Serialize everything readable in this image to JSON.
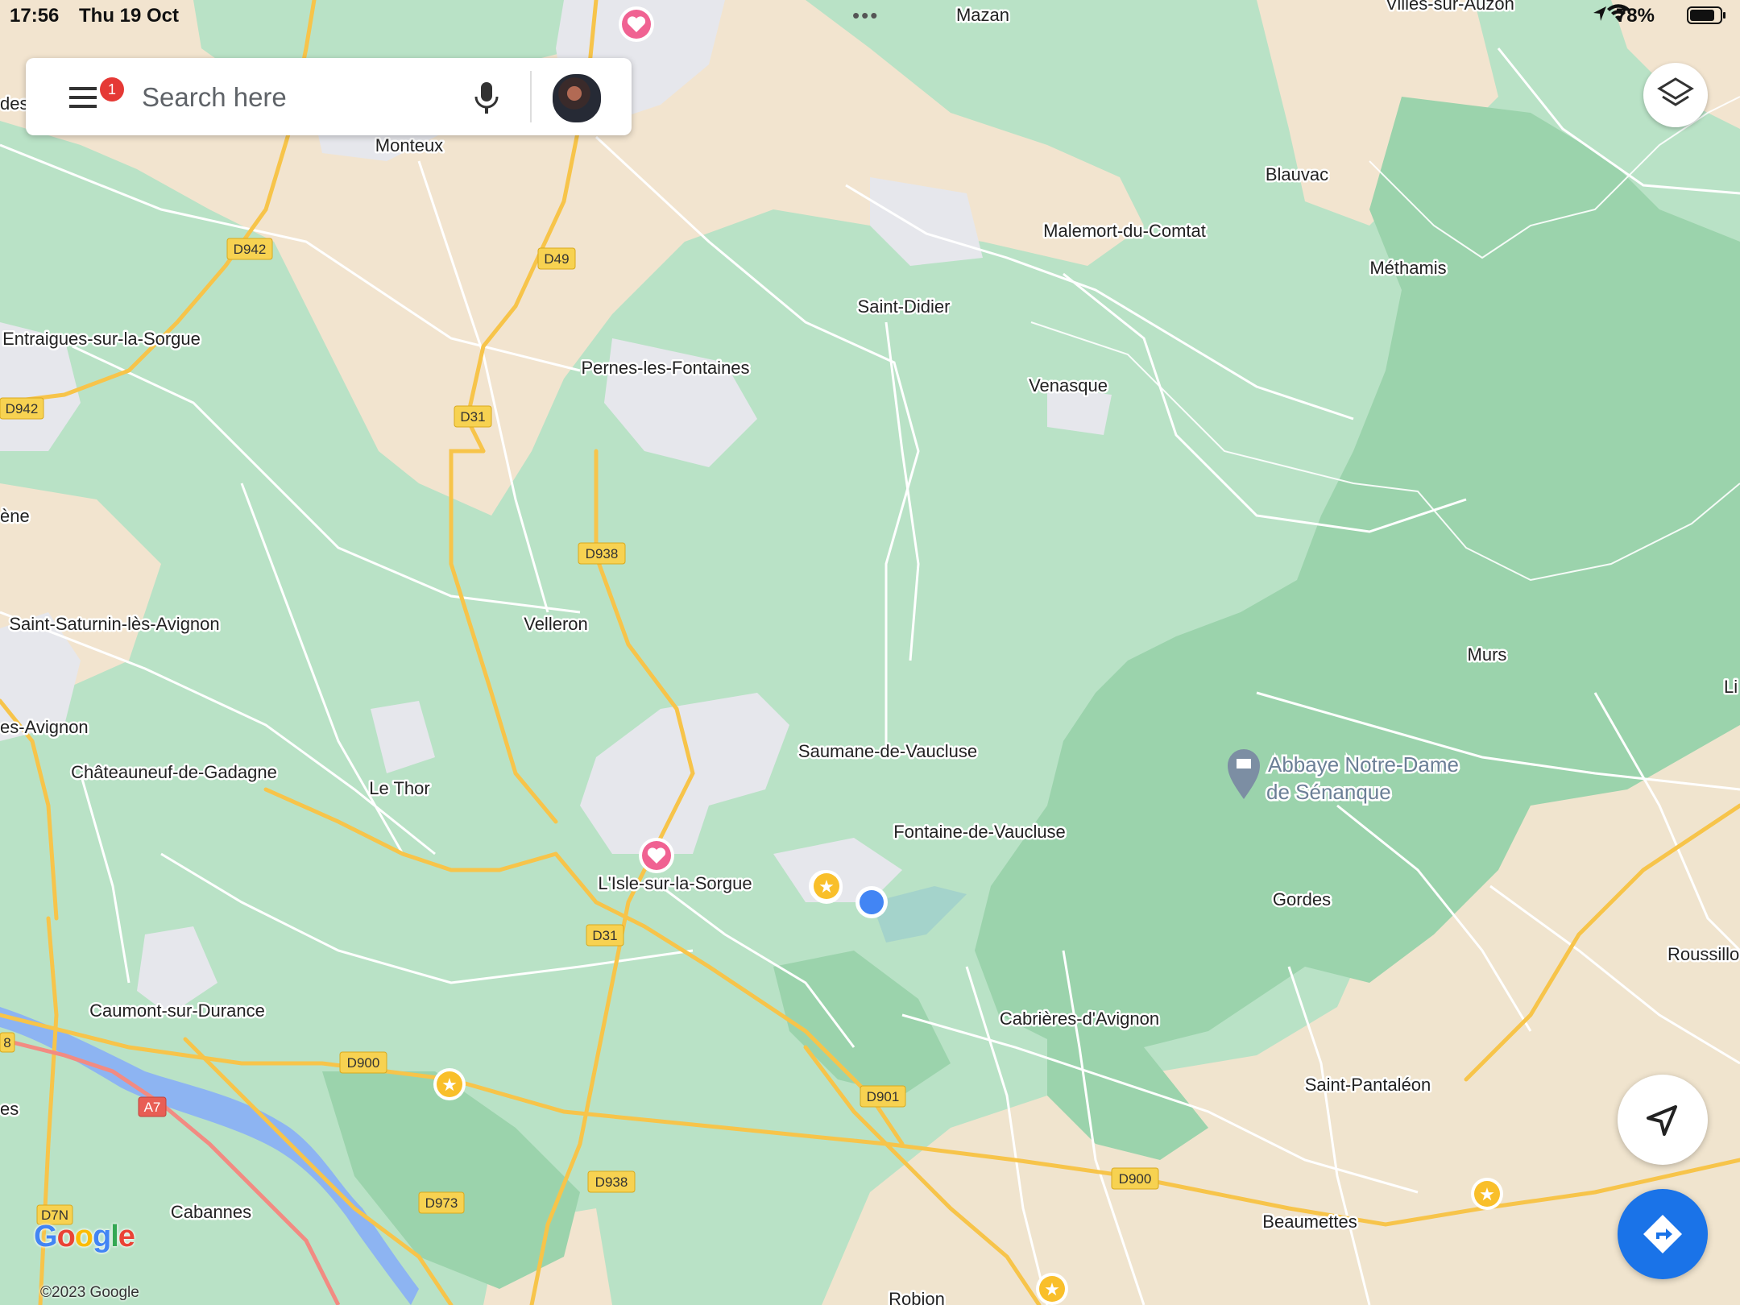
{
  "status_bar": {
    "time": "17:56",
    "date": "Thu 19 Oct",
    "battery": "78%"
  },
  "search": {
    "placeholder": "Search here",
    "notification_count": "1"
  },
  "places": [
    {
      "name": "Mazan"
    },
    {
      "name": "Villes-sur-Auzon"
    },
    {
      "name": "Monteux"
    },
    {
      "name": "Blauvac"
    },
    {
      "name": "Malemort-du-Comtat"
    },
    {
      "name": "Méthamis"
    },
    {
      "name": "Saint-Didier"
    },
    {
      "name": "Entraigues-sur-la-Sorgue"
    },
    {
      "name": "Pernes-les-Fontaines"
    },
    {
      "name": "Venasque"
    },
    {
      "name": "ène"
    },
    {
      "name": "Saint-Saturnin-lès-Avignon"
    },
    {
      "name": "Velleron"
    },
    {
      "name": "Murs"
    },
    {
      "name": "Li"
    },
    {
      "name": "es-Avignon"
    },
    {
      "name": "Saumane-de-Vaucluse"
    },
    {
      "name": "Châteauneuf-de-Gadagne"
    },
    {
      "name": "Le Thor"
    },
    {
      "name": "Fontaine-de-Vaucluse"
    },
    {
      "name": "L'Isle-sur-la-Sorgue"
    },
    {
      "name": "Gordes"
    },
    {
      "name": "Roussillo"
    },
    {
      "name": "Caumont-sur-Durance"
    },
    {
      "name": "Cabrières-d'Avignon"
    },
    {
      "name": "Saint-Pantaléon"
    },
    {
      "name": "es"
    },
    {
      "name": "Cabannes"
    },
    {
      "name": "Beaumettes"
    },
    {
      "name": "Robion"
    },
    {
      "name": "des"
    }
  ],
  "poi": {
    "line1": "Abbaye Notre-Dame",
    "line2": "de Sénanque"
  },
  "roads": [
    {
      "ref": "D942"
    },
    {
      "ref": "D49"
    },
    {
      "ref": "D942"
    },
    {
      "ref": "D31"
    },
    {
      "ref": "D938"
    },
    {
      "ref": "D31"
    },
    {
      "ref": "D900"
    },
    {
      "ref": "D901"
    },
    {
      "ref": "D900"
    },
    {
      "ref": "D938"
    },
    {
      "ref": "D973"
    },
    {
      "ref": "A7"
    },
    {
      "ref": "D7N"
    },
    {
      "ref": "8"
    }
  ],
  "map": {
    "attribution": "©2023 Google",
    "logo": "Google"
  },
  "icons": [
    "menu-icon",
    "mic-icon",
    "layers-icon",
    "navigation-arrow-icon",
    "directions-icon",
    "heart-pin-icon",
    "star-pin-icon",
    "my-location-dot"
  ],
  "colors": {
    "forest": "#b9e2c6",
    "dense_forest": "#9bd3ac",
    "urban": "#f2e4cf",
    "built_up": "#e6e7ec",
    "major_road": "#f7c44a",
    "road": "#ffffff",
    "water": "#8db4f2",
    "accent": "#1a73e8",
    "heart_pin": "#f06292",
    "star_pin": "#f9bf2a"
  }
}
